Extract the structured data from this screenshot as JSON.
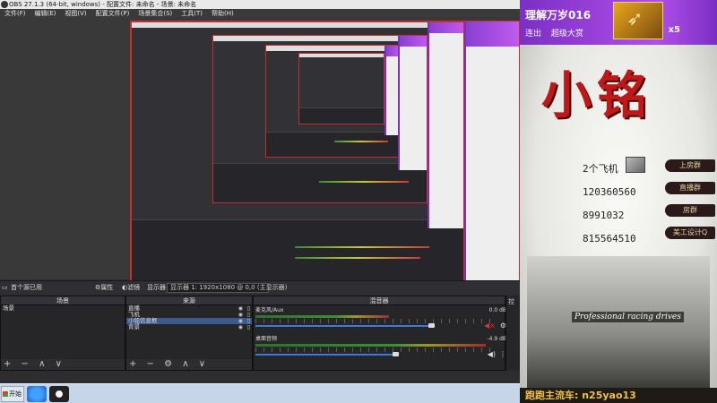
{
  "window": {
    "title": "OBS 27.1.3 (64-bit, windows) - 配置文件: 未命名 - 场景: 未命名"
  },
  "menu": [
    "文件(F)",
    "编辑(E)",
    "视图(V)",
    "配置文件(P)",
    "场景集合(S)",
    "工具(T)",
    "帮助(H)"
  ],
  "sourcebar": {
    "no_source": "首个源已用",
    "properties": "属性",
    "filters": "滤镜",
    "display_label": "显示器",
    "display_value": "显示器 1: 1920x1080 @ 0,0 (主显示器)"
  },
  "scenes": {
    "header": "场景",
    "items": [
      "场景"
    ]
  },
  "sources": {
    "header": "来源",
    "items": [
      "直播",
      "飞机",
      "小铭信息框",
      "背景"
    ]
  },
  "mixer": {
    "header": "混音器",
    "tracks": [
      {
        "name": "麦克风/Aux",
        "value": "0.0 dB",
        "level": 0.55,
        "volume": 0.85
      },
      {
        "name": "桌面音频",
        "value": "-4.9 dB",
        "level": 0.95,
        "volume": 0.68
      }
    ]
  },
  "controls_cut": "控",
  "footer_controls": "+ − ∧ ∨",
  "footer_controls_sources": "+ − ⚙ ∧ ∨",
  "taskbar": {
    "start": "开始"
  },
  "stream": {
    "name": "理解万岁016",
    "links": [
      "连出",
      "超级大赏"
    ],
    "badge_count": "x5",
    "calligraphy": "小铭",
    "info": [
      "2个飞机",
      "120360560",
      "8991032",
      "815564510"
    ],
    "side_labels": [
      "上房群",
      "直播群",
      "房群",
      "美工设计Q"
    ],
    "pro_text": "Professional racing drives",
    "pro_highlight": "racing",
    "banner": "跑跑主流车: n25yao13"
  },
  "colors": {
    "accent_purple": "#9b45dc",
    "border_red": "#c43030",
    "meter_green": "#3a9a3a"
  }
}
